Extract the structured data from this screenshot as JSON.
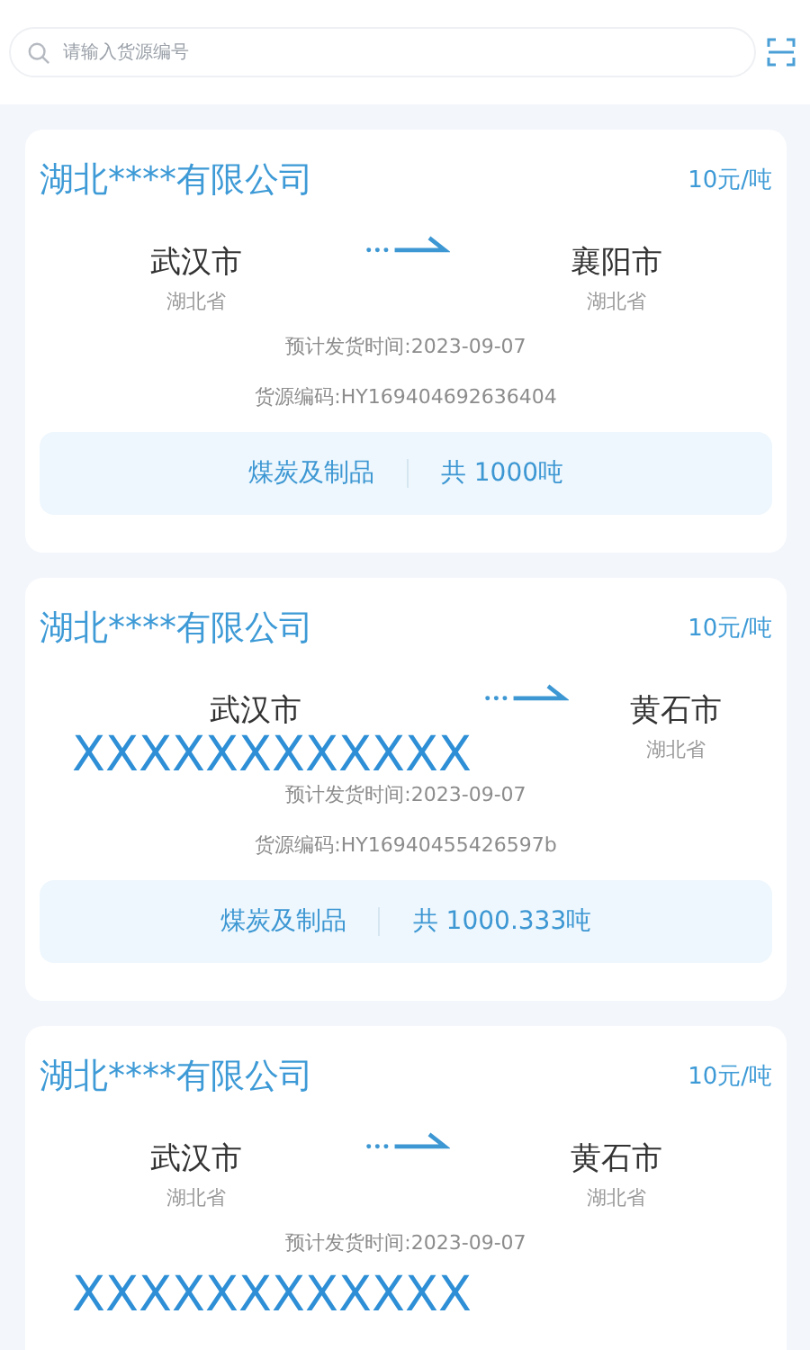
{
  "search": {
    "placeholder": "请输入货源编号"
  },
  "cards": [
    {
      "company": "湖北****有限公司",
      "price": "10元/吨",
      "from": {
        "city": "武汉市",
        "province": "湖北省"
      },
      "to": {
        "city": "襄阳市",
        "province": "湖北省"
      },
      "ship_time": "预计发货时间:2023-09-07",
      "code": "货源编码:HY169404692636404",
      "category": "煤炭及制品",
      "total": "共 1000吨"
    },
    {
      "company": "湖北****有限公司",
      "price": "10元/吨",
      "from": {
        "city": "武汉市"
      },
      "to": {
        "city": "黄石市",
        "province": "湖北省"
      },
      "ship_time": "预计发货时间:2023-09-07",
      "code": "货源编码:HY16940455426597b",
      "category": "煤炭及制品",
      "total": "共 1000.333吨",
      "route_overlay": "XXXXXXXXXXXX"
    },
    {
      "company": "湖北****有限公司",
      "price": "10元/吨",
      "from": {
        "city": "武汉市",
        "province": "湖北省"
      },
      "to": {
        "city": "黄石市",
        "province": "湖北省"
      },
      "ship_time": "预计发货时间:2023-09-07",
      "footer_overlay": "XXXXXXXXXXXX"
    }
  ]
}
